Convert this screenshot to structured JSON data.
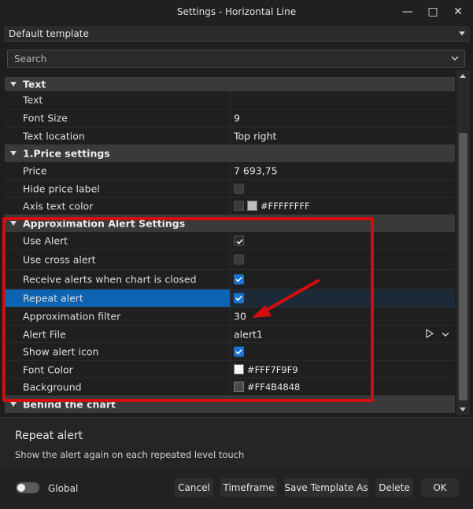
{
  "window": {
    "title": "Settings - Horizontal Line",
    "controls": {
      "minimize": "—",
      "maximize": "□",
      "close": "✕"
    }
  },
  "template": {
    "value": "Default template"
  },
  "search": {
    "placeholder": "Search"
  },
  "rows": [
    {
      "kind": "category",
      "label": "Text"
    },
    {
      "kind": "prop",
      "label": "Text",
      "value": ""
    },
    {
      "kind": "prop",
      "label": "Font Size",
      "value": "9"
    },
    {
      "kind": "prop",
      "label": "Text location",
      "value": "Top right"
    },
    {
      "kind": "category",
      "label": "1.Price settings"
    },
    {
      "kind": "prop",
      "label": "Price",
      "value": "7 693,75"
    },
    {
      "kind": "prop",
      "label": "Hide price label",
      "checkbox": "off"
    },
    {
      "kind": "prop",
      "label": "Axis text color",
      "color": "#FFFFFFFF"
    },
    {
      "kind": "category",
      "label": "Approximation Alert Settings"
    },
    {
      "kind": "prop",
      "label": "Use Alert",
      "checkbox": "checked-plain"
    },
    {
      "kind": "prop",
      "label": "Use cross alert",
      "checkbox": "off"
    },
    {
      "kind": "prop",
      "label": "Receive alerts when chart is closed",
      "checkbox": "checked"
    },
    {
      "kind": "prop",
      "label": "Repeat alert",
      "checkbox": "checked",
      "selected": true
    },
    {
      "kind": "prop",
      "label": "Approximation filter",
      "value": "30"
    },
    {
      "kind": "prop",
      "label": "Alert File",
      "value": "alert1"
    },
    {
      "kind": "prop",
      "label": "Show alert icon",
      "checkbox": "checked"
    },
    {
      "kind": "prop",
      "label": "Font Color",
      "color": "#FFF7F9F9"
    },
    {
      "kind": "prop",
      "label": "Background",
      "color": "#FF4B4848"
    },
    {
      "kind": "category",
      "label": "Behind the chart"
    }
  ],
  "description": {
    "title": "Repeat alert",
    "text": "Show the alert again on each repeated level touch"
  },
  "footer": {
    "global_label": "Global",
    "buttons": {
      "cancel": "Cancel",
      "timeframe": "Timeframe",
      "save_template": "Save Template As",
      "delete": "Delete",
      "ok": "OK"
    }
  },
  "colors": {
    "highlight": "#d40e0e",
    "selection": "#0b63b2",
    "checkbox": "#1a73d0"
  }
}
